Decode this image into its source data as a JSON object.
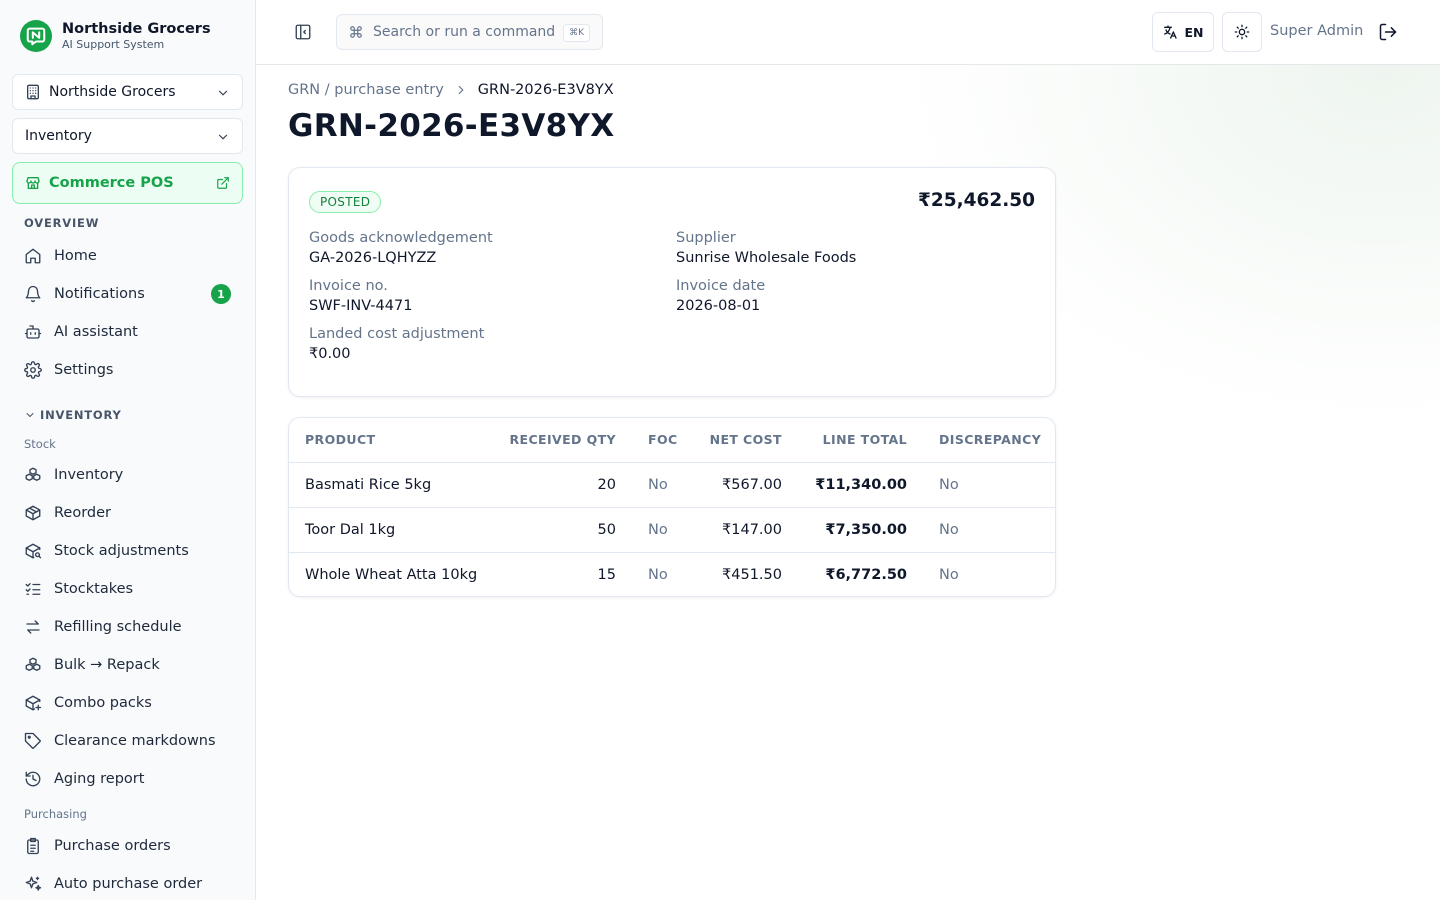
{
  "brand": {
    "name": "Northside Grocers",
    "subtitle": "AI Support System"
  },
  "sidebar": {
    "org_select": "Northside Grocers",
    "module_select": "Inventory",
    "pos_button": "Commerce POS",
    "overview_label": "OVERVIEW",
    "overview_items": [
      {
        "label": "Home",
        "icon": "home-icon"
      },
      {
        "label": "Notifications",
        "icon": "bell-icon",
        "badge": "1"
      },
      {
        "label": "AI assistant",
        "icon": "bot-icon"
      },
      {
        "label": "Settings",
        "icon": "gear-icon"
      }
    ],
    "inventory_label": "INVENTORY",
    "stock_label": "Stock",
    "stock_items": [
      {
        "label": "Inventory",
        "icon": "boxes-icon"
      },
      {
        "label": "Reorder",
        "icon": "package-icon"
      },
      {
        "label": "Stock adjustments",
        "icon": "package-search-icon"
      },
      {
        "label": "Stocktakes",
        "icon": "list-checks-icon"
      },
      {
        "label": "Refilling schedule",
        "icon": "arrows-exchange-icon"
      },
      {
        "label": "Bulk → Repack",
        "icon": "boxes-icon"
      },
      {
        "label": "Combo packs",
        "icon": "package-plus-icon"
      },
      {
        "label": "Clearance markdowns",
        "icon": "tag-icon"
      },
      {
        "label": "Aging report",
        "icon": "history-icon"
      }
    ],
    "purchasing_label": "Purchasing",
    "purchasing_items": [
      {
        "label": "Purchase orders",
        "icon": "clipboard-icon"
      },
      {
        "label": "Auto purchase order",
        "icon": "sparkles-icon"
      }
    ]
  },
  "topbar": {
    "search_placeholder": "Search or run a command",
    "search_shortcut": "⌘K",
    "language": "EN",
    "user": "Super Admin"
  },
  "breadcrumb": {
    "parent": "GRN / purchase entry",
    "current": "GRN-2026-E3V8YX"
  },
  "page_title": "GRN-2026-E3V8YX",
  "summary": {
    "status": "POSTED",
    "total": "₹25,462.50",
    "fields": {
      "goods_ack": {
        "label": "Goods acknowledgement",
        "value": "GA-2026-LQHYZZ"
      },
      "supplier": {
        "label": "Supplier",
        "value": "Sunrise Wholesale Foods"
      },
      "invoice_no": {
        "label": "Invoice no.",
        "value": "SWF-INV-4471"
      },
      "invoice_date": {
        "label": "Invoice date",
        "value": "2026-08-01"
      },
      "landed_cost": {
        "label": "Landed cost adjustment",
        "value": "₹0.00"
      }
    }
  },
  "lines_table": {
    "headers": [
      "PRODUCT",
      "RECEIVED QTY",
      "FOC",
      "NET COST",
      "LINE TOTAL",
      "DISCREPANCY"
    ],
    "rows": [
      {
        "product": "Basmati Rice 5kg",
        "qty": "20",
        "foc": "No",
        "net_cost": "₹567.00",
        "line_total": "₹11,340.00",
        "discrepancy": "No"
      },
      {
        "product": "Toor Dal 1kg",
        "qty": "50",
        "foc": "No",
        "net_cost": "₹147.00",
        "line_total": "₹7,350.00",
        "discrepancy": "No"
      },
      {
        "product": "Whole Wheat Atta 10kg",
        "qty": "15",
        "foc": "No",
        "net_cost": "₹451.50",
        "line_total": "₹6,772.50",
        "discrepancy": "No"
      }
    ]
  },
  "colors": {
    "accent": "#16a34a",
    "accent_soft": "#ecfdf3",
    "border": "#e2e8f0",
    "muted": "#64748b"
  }
}
